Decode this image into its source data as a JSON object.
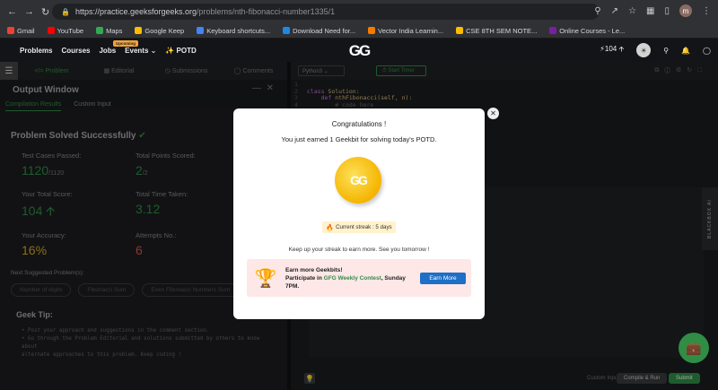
{
  "browser": {
    "url_host": "https://practice.geeksforgeeks.org",
    "url_path": "/problems/nth-fibonacci-number1335/1",
    "profile_initial": "m"
  },
  "bookmarks": [
    {
      "label": "Gmail",
      "color": "#ea4335"
    },
    {
      "label": "YouTube",
      "color": "#ff0000"
    },
    {
      "label": "Maps",
      "color": "#34a853"
    },
    {
      "label": "Google Keep",
      "color": "#fbbc04"
    },
    {
      "label": "Keyboard shortcuts...",
      "color": "#4285f4"
    },
    {
      "label": "Download Need for...",
      "color": "#1e88e5"
    },
    {
      "label": "Vector India Learnin...",
      "color": "#f57c00"
    },
    {
      "label": "CSE 8TH SEM NOTE...",
      "color": "#fbbc04"
    },
    {
      "label": "Online Courses - Le...",
      "color": "#7b1fa2"
    }
  ],
  "gfgnav": {
    "problems": "Problems",
    "courses": "Courses",
    "jobs": "Jobs",
    "events": "Events ⌄",
    "upcoming": "Upcoming",
    "potd": "POTD",
    "logo": "GG",
    "geekbits": "104"
  },
  "lefttabs": {
    "problem": "Problem",
    "editorial": "Editorial",
    "submissions": "Submissions",
    "comments": "Comments"
  },
  "output": {
    "title": "Output Window",
    "tab_results": "Compilation Results",
    "tab_custom": "Custom Input",
    "solved": "Problem Solved Successfully"
  },
  "stats": {
    "test_cases_label": "Test Cases Passed:",
    "test_cases_value": "1120",
    "test_cases_total": "/1120",
    "points_label": "Total Points Scored:",
    "points_value": "2",
    "points_total": "/2",
    "score_label": "Your Total Score:",
    "score_value": "104",
    "time_label": "Total Time Taken:",
    "time_value": "3.12",
    "accuracy_label": "Your Accuracy:",
    "accuracy_value": "16%",
    "attempts_label": "Attempts No.:",
    "attempts_value": "6",
    "accuracy_color": "#d4a72c",
    "attempts_color": "#d9534f"
  },
  "next": {
    "label": "Next Suggested Problem(s):",
    "chips": [
      "Number of digits",
      "Fibonacci Sum",
      "Even Fibonacci Numbers Sum"
    ]
  },
  "geektip": {
    "title": "Geek Tip:",
    "line1": "• Post your approach and suggestions in the comment section.",
    "line2": "• Go through the Problem Editorial and solutions submitted by others to know about",
    "line3": "  alternate approaches to this problem. Keep coding !"
  },
  "editor": {
    "language": "Python3",
    "timer": "Start Timer",
    "line1": "1",
    "line2": "2",
    "line3": "3",
    "line4": "4",
    "code_class": "class",
    "code_solution": " Solution:",
    "code_def": "def",
    "code_method": " nthFibonacci(self, n):",
    "code_comment": "# code here",
    "blackbox": "BLACKBOX AI",
    "custom_input": "Custom Input",
    "compile": "Compile & Run",
    "submit": "Submit"
  },
  "modal": {
    "title": "Congratulations !",
    "subtitle": "You just earned 1 Geekbit for solving today's POTD.",
    "coin_logo": "GG",
    "streak": "Current streak : 5 days",
    "keep": "Keep up your streak to earn more. See you tomorrow !",
    "contest_line1": "Earn more Geekbits!",
    "contest_line2a": "Participate in",
    "contest_gfg": "GFG Weekly Contest",
    "contest_line2b": ", Sunday 7PM.",
    "earn_more": "Earn More"
  }
}
